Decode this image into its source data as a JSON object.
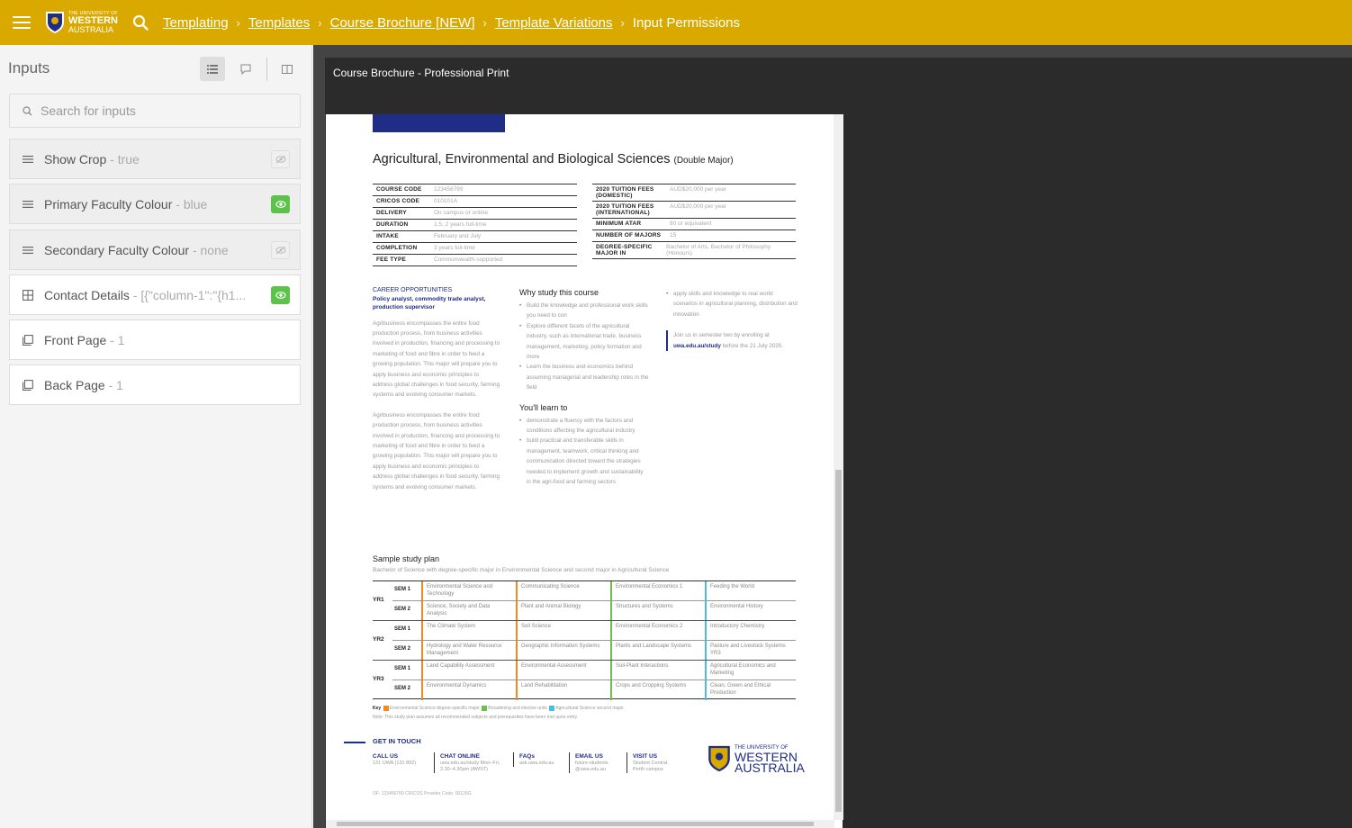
{
  "header": {
    "logo": {
      "line1": "THE UNIVERSITY OF",
      "line2": "WESTERN",
      "line3": "AUSTRALIA"
    },
    "breadcrumbs": [
      "Templating",
      "Templates",
      "Course Brochure [NEW]",
      "Template Variations"
    ],
    "current": "Input Permissions"
  },
  "sidebar": {
    "title": "Inputs",
    "search_placeholder": "Search for inputs",
    "items": [
      {
        "label": "Show Crop",
        "value": "- true",
        "icon": "list-icon",
        "visible": false
      },
      {
        "label": "Primary Faculty Colour",
        "value": "- blue",
        "icon": "list-icon",
        "visible": true
      },
      {
        "label": "Secondary Faculty Colour",
        "value": "- none",
        "icon": "list-icon",
        "visible": false
      },
      {
        "label": "Contact Details",
        "value": "- [{\"column-1\":\"{h1...",
        "icon": "table-icon",
        "visible": true
      },
      {
        "label": "Front Page",
        "value": "- 1",
        "icon": "page-icon",
        "visible": null
      },
      {
        "label": "Back Page",
        "value": "- 1",
        "icon": "page-icon",
        "visible": null
      }
    ]
  },
  "viewer": {
    "title": "Course Brochure - Professional Print"
  },
  "brochure": {
    "title": "Agricultural, Environmental and Biological Sciences",
    "title_suffix": "(Double Major)",
    "facts_left": [
      {
        "k": "COURSE CODE",
        "v": "123456789"
      },
      {
        "k": "CRICOS CODE",
        "v": "010101A"
      },
      {
        "k": "DELIVERY",
        "v": "On campus or online"
      },
      {
        "k": "DURATION",
        "v": "1.5, 2 years full-time"
      },
      {
        "k": "INTAKE",
        "v": "February and July"
      },
      {
        "k": "COMPLETION",
        "v": "3 years full-time"
      },
      {
        "k": "FEE TYPE",
        "v": "Commonwealth-supported"
      }
    ],
    "facts_right": [
      {
        "k": "2020 TUITION FEES (DOMESTIC)",
        "v": "AUD$20,000 per year"
      },
      {
        "k": "2020 TUITION FEES (INTERNATIONAL)",
        "v": "AUD$20,000 per year"
      },
      {
        "k": "MINIMUM ATAR",
        "v": "80 or equivalent"
      },
      {
        "k": "NUMBER OF MAJORS",
        "v": "15"
      },
      {
        "k": "DEGREE-SPECIFIC MAJOR IN",
        "v": "Bachelor of Arts, Bachelor of Philosophy (Honours)"
      }
    ],
    "career_heading": "CAREER OPPORTUNITIES",
    "career_list": "Policy analyst, commodity trade analyst, production supervisor",
    "para": "Agribusiness encompasses the entire food production process, from business activities involved in production, financing and processing to marketing of food and fibre in order to feed a growing population. This major will prepare you to apply business and economic principles to address global challenges in food security, farming systems and evolving consumer markets.",
    "why_heading": "Why study this course",
    "why": [
      "Build the knowledge and professional work skills you need to con",
      "Explore different facets of the agricultural industry, such as international trade, business management, marketing, policy formation and more",
      "Learn the business and economics behind assuming managerial and leadership roles in the field"
    ],
    "learn_heading": "You'll learn to",
    "learn": [
      "demonstrate a fluency with the factors and conditions affecting the agricultural industry",
      "build practical and transferable skills in management, teamwork, critical thinking and communication directed toward the strategies needed to implement growth and sustainability in the agri-food and farming sectors"
    ],
    "right_bullet": "apply skills and knowledge to real world scenarios in agricultural planning, distribution and innovation",
    "join_pre": "Join us in semester two by enrolling at",
    "join_link": "uwa.edu.au/study",
    "join_post": "before the 21 July 2020.",
    "plan_heading": "Sample study plan",
    "plan_sub": "Bachelor of Science with degree-specific major in Environmental Science and second major in Agricultural Science",
    "plan": [
      {
        "yr": "YR1",
        "sems": [
          {
            "sem": "SEM 1",
            "units": [
              "Environmental Science and Technology",
              "Communicating Science",
              "Environmental Economics 1",
              "Feeding the World"
            ]
          },
          {
            "sem": "SEM 2",
            "units": [
              "Science, Society and Data Analysis",
              "Plant and Animal Biology",
              "Structures and Systems",
              "Environmental History"
            ]
          }
        ]
      },
      {
        "yr": "YR2",
        "sems": [
          {
            "sem": "SEM 1",
            "units": [
              "The Climate System",
              "Soil Science",
              "Environmental Economics 2",
              "Introductory Chemistry"
            ]
          },
          {
            "sem": "SEM 2",
            "units": [
              "Hydrology and Water Resource Management",
              "Geographic Information Systems",
              "Plants and Landscape Systems",
              "Pasture and Livestock Systems YR3"
            ]
          }
        ]
      },
      {
        "yr": "YR3",
        "sems": [
          {
            "sem": "SEM 1",
            "units": [
              "Land Capability Assessment",
              "Environmental Assessment",
              "Soil-Plant Interactions",
              "Agricultural Economics and Marketing"
            ]
          },
          {
            "sem": "SEM 2",
            "units": [
              "Environmental Dynamics",
              "Land Rehabilitation",
              "Crops and Cropping Systems",
              "Clean, Green and Ethical Production"
            ]
          }
        ]
      }
    ],
    "column_colors": [
      "#f08a24",
      "#f08a24",
      "#6cc04a",
      "#4bbde0"
    ],
    "key_label": "Key",
    "key_items": [
      {
        "color": "#f08a24",
        "text": "Environmental Science degree-specific major"
      },
      {
        "color": "#6cc04a",
        "text": "Broadening and elective units"
      },
      {
        "color": "#4bbde0",
        "text": "Agricultural Science second major"
      }
    ],
    "note": "Note: This study plan assumes all recommended subjects and prerequisites have been met upon entry.",
    "get_in_touch": "GET IN TOUCH",
    "contacts": [
      {
        "h": "CALL US",
        "t": "131 UWA (131 892)"
      },
      {
        "h": "CHAT ONLINE",
        "t": "uwa.edu.au/study Mon–Fri, 2.30–4.30pm (AWST)"
      },
      {
        "h": "FAQs",
        "t": "ask.uwa.edu.au"
      },
      {
        "h": "EMAIL US",
        "t": "future-students @uwa.edu.au"
      },
      {
        "h": "VISIT US",
        "t": "Student Central, Perth campus"
      }
    ],
    "footer": "OF: 123456789    CRICOS Provider Code: 00126G"
  }
}
